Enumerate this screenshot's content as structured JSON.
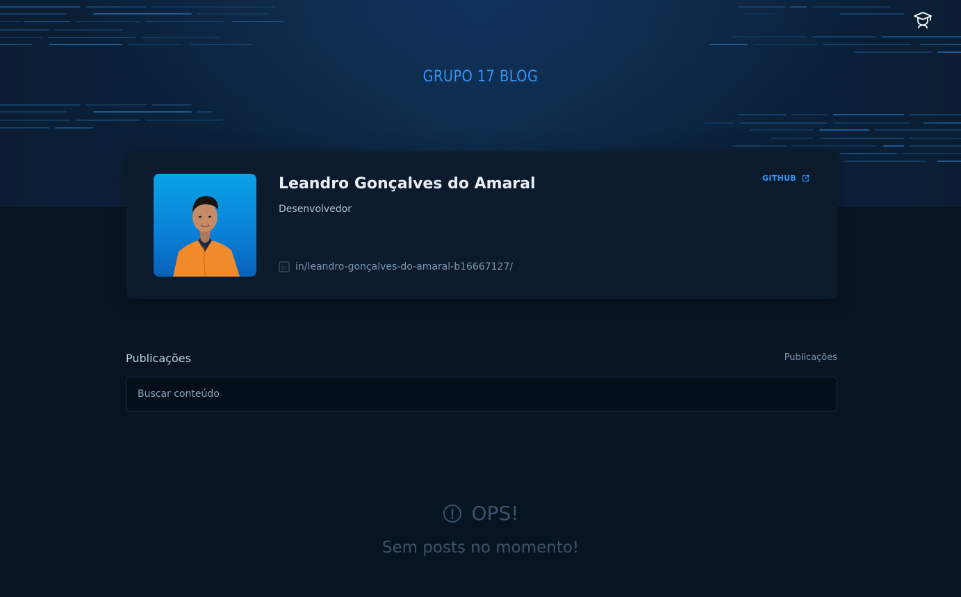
{
  "header": {
    "title": "GRUPO 17 BLOG",
    "icon": "graduation-cap-icon"
  },
  "profile": {
    "name": "Leandro Gonçalves do Amaral",
    "role": "Desenvolvedor",
    "github_label": "GITHUB",
    "github_icon": "external-link-icon",
    "linkedin": "in/leandro-gonçalves-do-amaral-b16667127/",
    "linkedin_icon": "linkedin-icon"
  },
  "publications": {
    "title": "Publicações",
    "count_label": "Publicações",
    "search_placeholder": "Buscar conteúdo"
  },
  "empty_state": {
    "icon": "alert-circle-icon",
    "title": "OPS!",
    "message": "Sem posts no momento!"
  },
  "colors": {
    "background": "#071422",
    "accent": "#3294f8",
    "card": "#0b1b2b"
  }
}
